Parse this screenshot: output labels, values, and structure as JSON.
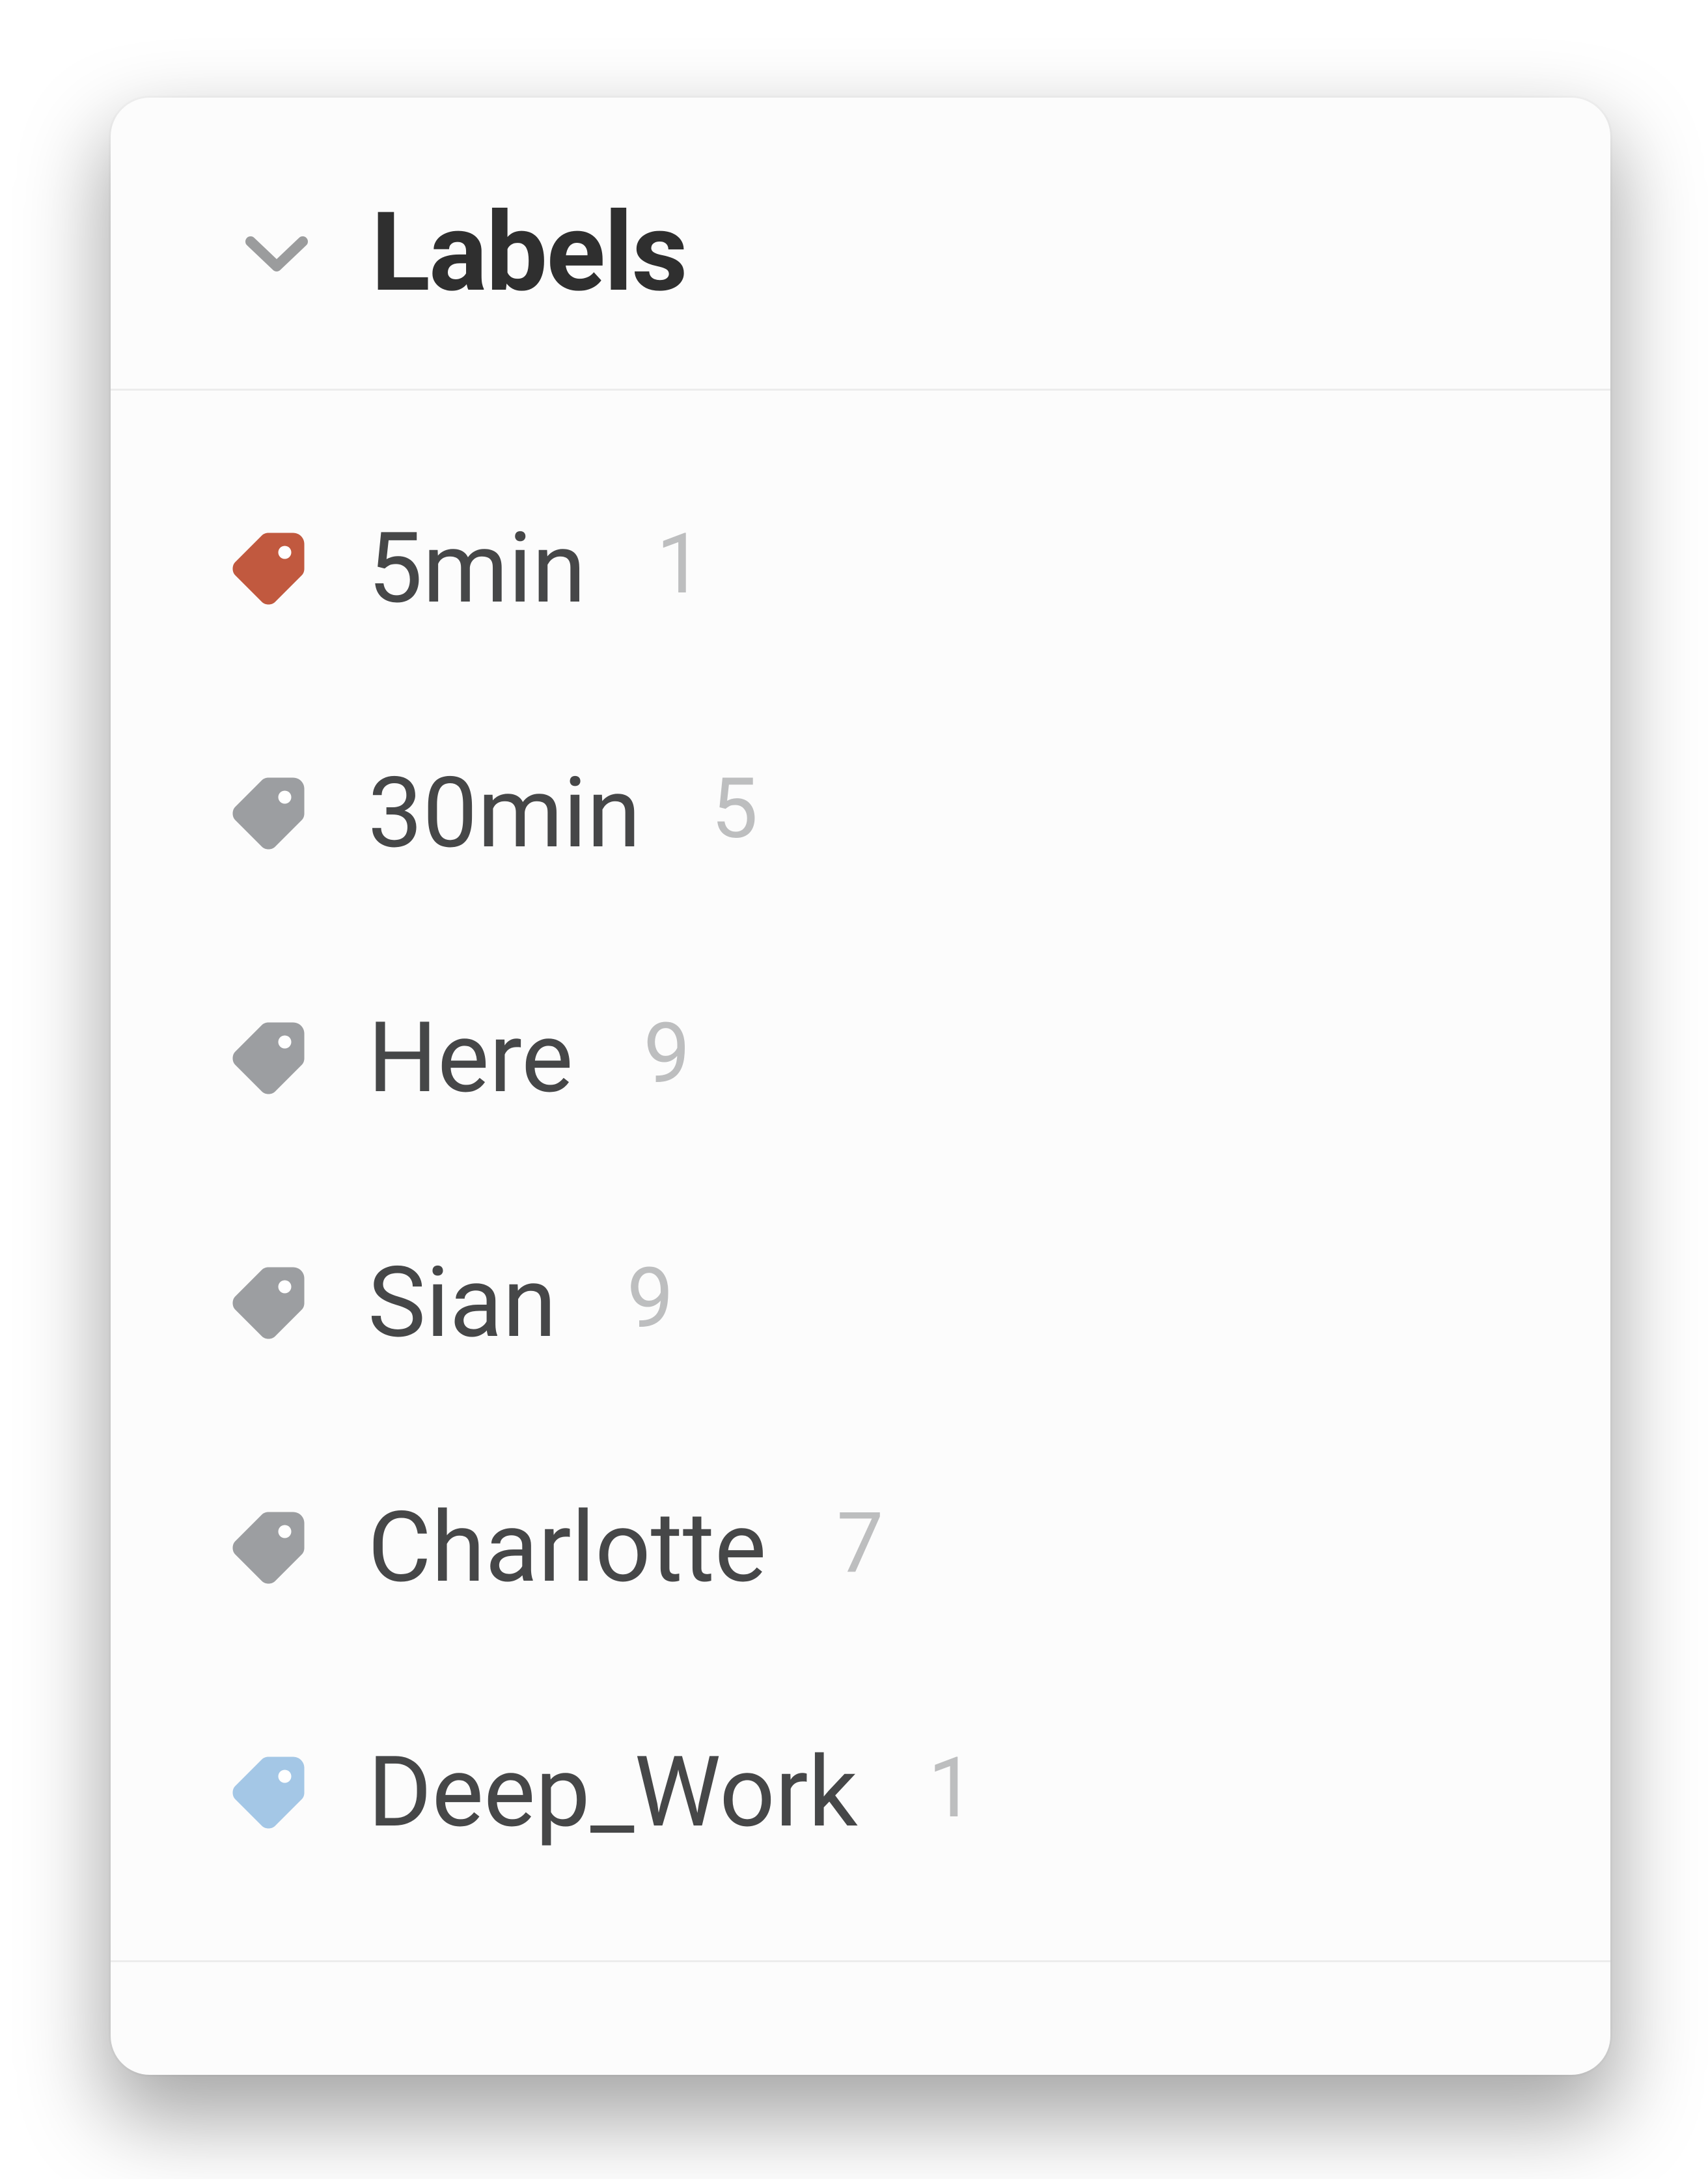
{
  "section": {
    "title": "Labels",
    "expanded": true
  },
  "labels": [
    {
      "name": "5min",
      "count": 1,
      "color": "red"
    },
    {
      "name": "30min",
      "count": 5,
      "color": "grey"
    },
    {
      "name": "Here",
      "count": 9,
      "color": "grey"
    },
    {
      "name": "Sian",
      "count": 9,
      "color": "grey"
    },
    {
      "name": "Charlotte",
      "count": 7,
      "color": "grey"
    },
    {
      "name": "Deep_Work",
      "count": 1,
      "color": "blue"
    }
  ],
  "colors": {
    "red": "#c1593f",
    "grey": "#9c9ea1",
    "blue": "#a4c7e6"
  }
}
